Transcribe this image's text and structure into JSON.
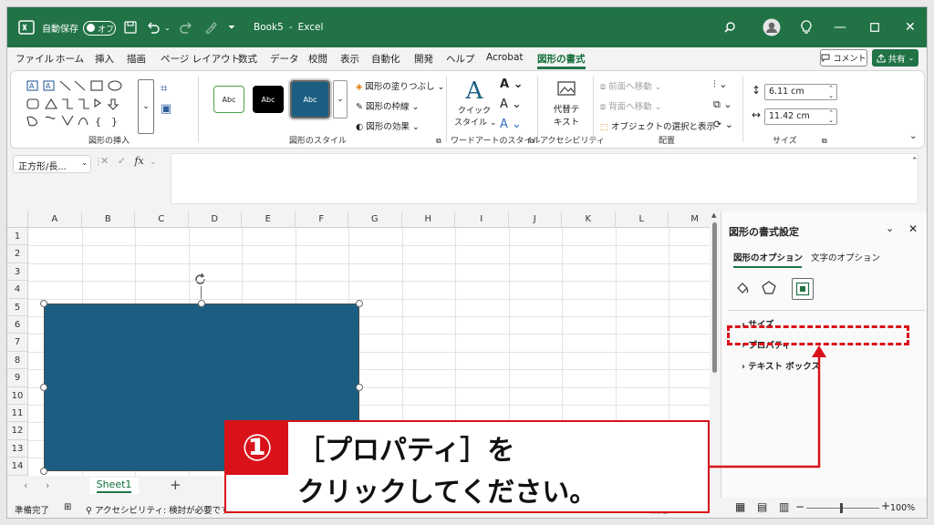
{
  "titlebar": {
    "autosave_label": "自動保存",
    "autosave_state": "オフ",
    "file_title": "Book5",
    "app_name": "Excel",
    "separator": "-"
  },
  "tabs": [
    "ファイル",
    "ホーム",
    "挿入",
    "描画",
    "ページ レイアウト",
    "数式",
    "データ",
    "校閲",
    "表示",
    "自動化",
    "開発",
    "ヘルプ",
    "Acrobat",
    "図形の書式"
  ],
  "active_tab": "図形の書式",
  "comment_label": "コメント",
  "share_label": "共有",
  "ribbon": {
    "insert_shapes_label": "図形の挿入",
    "shape_styles_label": "図形のスタイル",
    "style_sample": "Abc",
    "fill_label": "図形の塗りつぶし",
    "outline_label": "図形の枠線",
    "effect_label": "図形の効果",
    "quick_style_line1": "クイック",
    "quick_style_line2": "スタイル",
    "wordart_label": "ワードアートのスタイル",
    "alt_text_line1": "代替テ",
    "alt_text_line2": "キスト",
    "accessibility_label": "アクセシビリティ",
    "bring_forward": "前面へ移動",
    "send_backward": "背面へ移動",
    "selection_pane": "オブジェクトの選択と表示",
    "arrange_label": "配置",
    "height_value": "6.11 cm",
    "width_value": "11.42 cm",
    "size_label": "サイズ"
  },
  "formula_bar": {
    "name_box": "正方形/長...",
    "fx": "fx"
  },
  "columns": [
    "A",
    "B",
    "C",
    "D",
    "E",
    "F",
    "G",
    "H",
    "I",
    "J",
    "K",
    "L",
    "M"
  ],
  "rows": [
    "1",
    "2",
    "3",
    "4",
    "5",
    "6",
    "7",
    "8",
    "9",
    "10",
    "11",
    "12",
    "13",
    "14"
  ],
  "sheet_tab": "Sheet1",
  "status": {
    "ready": "準備完了",
    "accessibility": "アクセシビリティ: 検討が必要です",
    "settings_partial": "設定",
    "zoom": "100%"
  },
  "pane": {
    "title": "図形の書式設定",
    "tab_shape_options": "図形のオプション",
    "tab_text_options": "文字のオプション",
    "section_size": "サイズ",
    "section_properties": "プロパティ",
    "section_textbox": "テキスト ボックス"
  },
  "callout": {
    "number": "①",
    "line1": "［プロパティ］を",
    "line2": "クリックしてください。"
  },
  "colors": {
    "excel_green": "#217346",
    "shape_fill": "#1b5e82",
    "callout_red": "#d9121a"
  }
}
